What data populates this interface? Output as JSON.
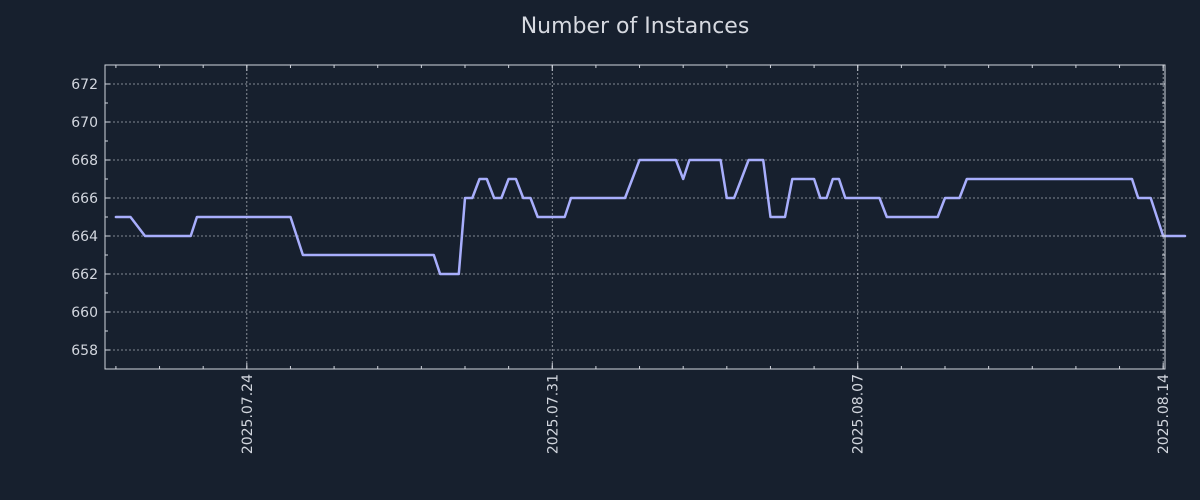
{
  "chart_data": {
    "type": "line",
    "title": "Number of Instances",
    "xlabel": "",
    "ylabel": "",
    "ylim": [
      657,
      673
    ],
    "y_ticks": [
      658,
      660,
      662,
      664,
      666,
      668,
      670,
      672
    ],
    "x_ticks": [
      "2025.07.24",
      "2025.07.31",
      "2025.08.07",
      "2025.08.14"
    ],
    "grid": true,
    "legend": "none",
    "colors": {
      "background": "#17202e",
      "line": "#a8aefc",
      "axis": "#d2d6de",
      "grid": "#c8ccd4",
      "text": "#d6d9e0"
    },
    "series": [
      {
        "x": [
          "2025.07.21",
          "2025.07.21",
          "2025.07.21",
          "2025.07.22",
          "2025.07.22",
          "2025.07.22",
          "2025.07.22",
          "2025.07.22",
          "2025.07.22",
          "2025.07.22",
          "2025.07.23",
          "2025.07.23",
          "2025.07.23",
          "2025.07.23",
          "2025.07.23",
          "2025.07.23",
          "2025.07.24",
          "2025.07.24",
          "2025.07.24",
          "2025.07.24",
          "2025.07.24",
          "2025.07.24",
          "2025.07.25",
          "2025.07.25",
          "2025.07.25",
          "2025.07.25",
          "2025.07.25",
          "2025.07.25",
          "2025.07.25",
          "2025.07.26",
          "2025.07.26",
          "2025.07.26",
          "2025.07.26",
          "2025.07.26",
          "2025.07.26",
          "2025.07.27",
          "2025.07.27",
          "2025.07.27",
          "2025.07.27",
          "2025.07.27",
          "2025.07.27",
          "2025.07.28",
          "2025.07.28",
          "2025.07.28",
          "2025.07.28",
          "2025.07.28",
          "2025.07.28",
          "2025.07.28",
          "2025.07.29",
          "2025.07.29",
          "2025.07.29",
          "2025.07.29",
          "2025.07.29",
          "2025.07.29",
          "2025.07.30",
          "2025.07.30",
          "2025.07.30",
          "2025.07.30",
          "2025.07.30",
          "2025.07.30",
          "2025.07.31",
          "2025.07.31",
          "2025.07.31",
          "2025.07.31",
          "2025.07.31",
          "2025.07.31",
          "2025.07.31",
          "2025.08.01",
          "2025.08.01",
          "2025.08.01",
          "2025.08.01",
          "2025.08.01",
          "2025.08.01",
          "2025.08.02",
          "2025.08.02",
          "2025.08.02",
          "2025.08.02",
          "2025.08.02",
          "2025.08.02",
          "2025.08.03",
          "2025.08.03",
          "2025.08.03",
          "2025.08.03",
          "2025.08.03",
          "2025.08.03",
          "2025.08.03",
          "2025.08.04",
          "2025.08.04",
          "2025.08.04",
          "2025.08.04",
          "2025.08.04",
          "2025.08.04",
          "2025.08.05",
          "2025.08.05",
          "2025.08.05",
          "2025.08.05",
          "2025.08.05",
          "2025.08.05",
          "2025.08.06",
          "2025.08.06",
          "2025.08.06",
          "2025.08.06",
          "2025.08.06",
          "2025.08.06",
          "2025.08.06",
          "2025.08.07",
          "2025.08.07",
          "2025.08.07",
          "2025.08.07",
          "2025.08.07",
          "2025.08.07",
          "2025.08.08",
          "2025.08.08",
          "2025.08.08",
          "2025.08.08",
          "2025.08.08",
          "2025.08.08",
          "2025.08.09",
          "2025.08.09",
          "2025.08.09",
          "2025.08.09",
          "2025.08.09",
          "2025.08.09",
          "2025.08.10",
          "2025.08.10",
          "2025.08.10",
          "2025.08.10",
          "2025.08.10",
          "2025.08.10",
          "2025.08.10",
          "2025.08.11",
          "2025.08.11",
          "2025.08.11",
          "2025.08.11",
          "2025.08.11",
          "2025.08.11",
          "2025.08.12",
          "2025.08.12",
          "2025.08.12",
          "2025.08.12",
          "2025.08.12",
          "2025.08.12",
          "2025.08.13",
          "2025.08.13",
          "2025.08.13",
          "2025.08.13",
          "2025.08.13",
          "2025.08.13",
          "2025.08.13",
          "2025.08.14",
          "2025.08.14"
        ],
        "values": [
          665,
          665,
          664,
          664,
          664,
          664,
          664,
          664,
          664,
          665,
          665,
          665,
          665,
          665,
          665,
          665,
          665,
          665,
          665,
          665,
          665,
          665,
          665,
          664,
          663,
          663,
          663,
          663,
          663,
          663,
          663,
          663,
          663,
          663,
          663,
          663,
          663,
          663,
          663,
          663,
          663,
          663,
          663,
          663,
          662,
          662,
          662,
          662,
          666,
          666,
          667,
          667,
          666,
          666,
          667,
          667,
          666,
          666,
          665,
          665,
          665,
          665,
          665,
          666,
          666,
          666,
          666,
          666,
          666,
          666,
          666,
          666,
          667,
          668,
          668,
          668,
          668,
          668,
          668,
          667,
          668,
          668,
          668,
          668,
          668,
          668,
          666,
          666,
          667,
          668,
          668,
          668,
          665,
          665,
          665,
          667,
          667,
          667,
          667,
          666,
          666,
          667,
          667,
          666,
          666,
          666,
          666,
          666,
          666,
          665,
          665,
          665,
          665,
          665,
          665,
          665,
          665,
          666,
          666,
          666,
          667,
          667,
          667,
          667,
          667,
          667,
          667,
          667,
          667,
          667,
          667,
          667,
          667,
          667,
          667,
          667,
          667,
          667,
          667,
          667,
          667,
          667,
          667,
          667,
          667,
          666,
          666,
          666,
          665,
          664,
          664
        ]
      }
    ]
  }
}
